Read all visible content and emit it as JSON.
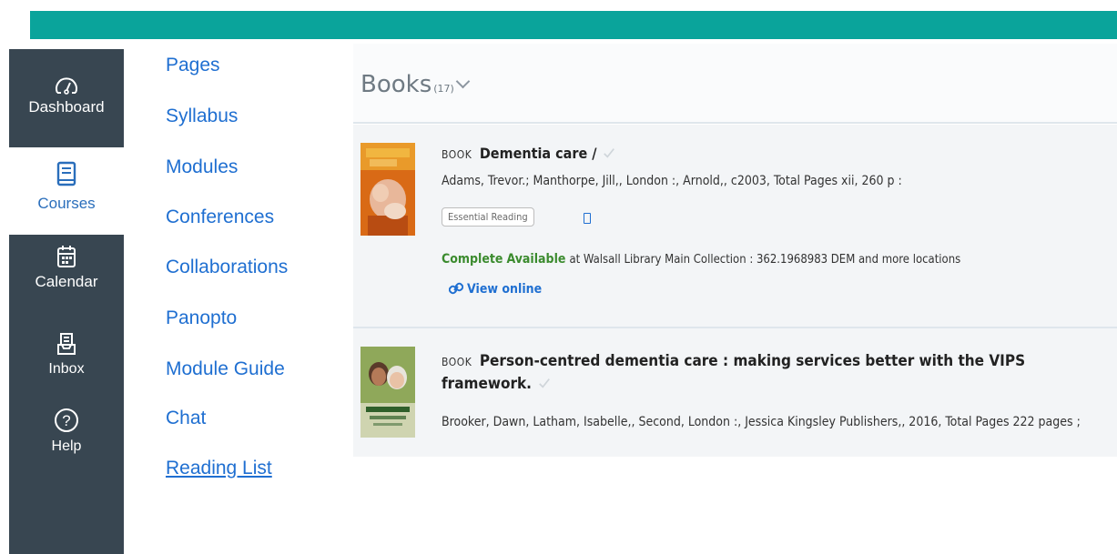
{
  "global_nav": {
    "dashboard": {
      "label": "Dashboard",
      "icon": "dashboard-gauge-icon"
    },
    "courses": {
      "label": "Courses",
      "icon": "book-icon"
    },
    "calendar": {
      "label": "Calendar",
      "icon": "calendar-icon"
    },
    "inbox": {
      "label": "Inbox",
      "icon": "inbox-icon"
    },
    "help": {
      "label": "Help",
      "icon": "help-circle-icon"
    }
  },
  "course_nav": {
    "items": [
      "Pages",
      "Syllabus",
      "Modules",
      "Conferences",
      "Collaborations",
      "Panopto",
      "Module Guide",
      "Chat",
      "Reading List"
    ]
  },
  "reading_list": {
    "section_title": "Books",
    "count": "(17)",
    "items": [
      {
        "type_label": "BOOK",
        "title": "Dementia care /",
        "authors": "Adams, Trevor.; Manthorpe, Jill,, London :, Arnold,, c2003, Total Pages xii, 260 p :",
        "tag": "Essential Reading",
        "status_complete": "Complete",
        "status_available": "Available",
        "location": "at Walsall Library Main Collection : 362.1968983 DEM and more locations",
        "view_online": "View online"
      },
      {
        "type_label": "BOOK",
        "title": "Person-centred dementia care : making services better with the VIPS framework.",
        "authors": "Brooker, Dawn, Latham, Isabelle,, Second, London :, Jessica Kingsley Publishers,, 2016, Total Pages 222 pages ;"
      }
    ]
  },
  "colors": {
    "topbar": "#0aa49b",
    "global_nav_bg": "#384651",
    "link": "#1f6fd1",
    "available_green": "#3b8b2e"
  }
}
